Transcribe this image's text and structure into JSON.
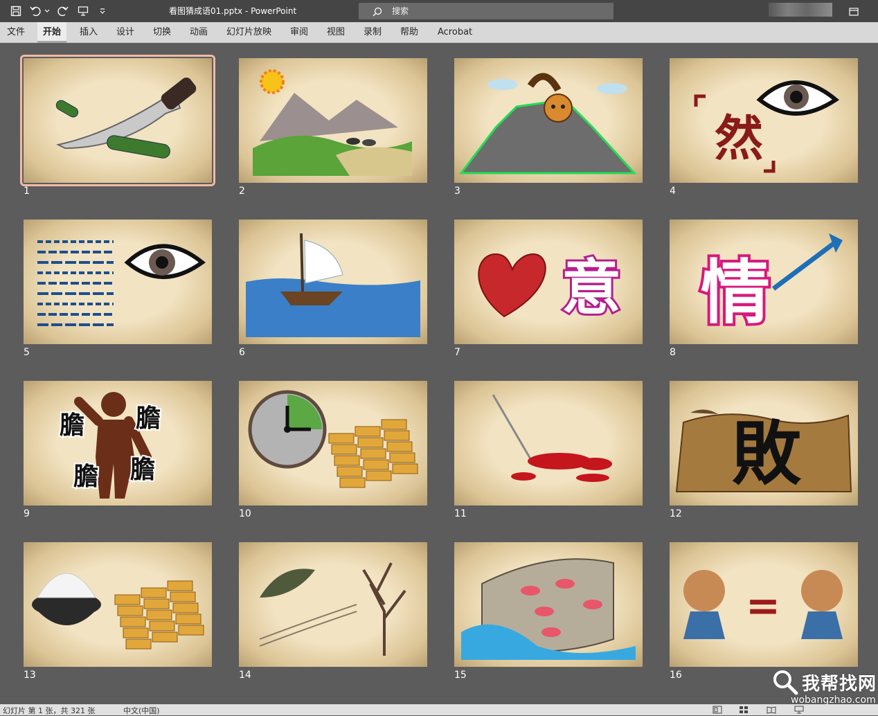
{
  "window": {
    "title": "看图猜成语01.pptx  -  PowerPoint"
  },
  "quick_access": [
    {
      "name": "save-icon"
    },
    {
      "name": "undo-icon"
    },
    {
      "name": "redo-icon"
    },
    {
      "name": "present-icon"
    },
    {
      "name": "customize-icon"
    }
  ],
  "search": {
    "placeholder": "搜索"
  },
  "ribbon": {
    "tabs": [
      "文件",
      "开始",
      "插入",
      "设计",
      "切换",
      "动画",
      "幻灯片放映",
      "审阅",
      "视图",
      "录制",
      "帮助",
      "Acrobat"
    ],
    "active_tab": "开始"
  },
  "slides": [
    {
      "number": "1",
      "selected": true,
      "art": "knife-cucumber"
    },
    {
      "number": "2",
      "art": "sun-mountains"
    },
    {
      "number": "3",
      "art": "raccoon-mountain"
    },
    {
      "number": "4",
      "art": "eye-ran"
    },
    {
      "number": "5",
      "art": "text-lines-eye"
    },
    {
      "number": "6",
      "art": "sailboat"
    },
    {
      "number": "7",
      "art": "heart-yi"
    },
    {
      "number": "8",
      "art": "qing-arrow"
    },
    {
      "number": "9",
      "art": "figure-dan"
    },
    {
      "number": "10",
      "art": "clock-gold"
    },
    {
      "number": "11",
      "art": "needle-blood"
    },
    {
      "number": "12",
      "art": "bai-cracked"
    },
    {
      "number": "13",
      "art": "rice-gold"
    },
    {
      "number": "14",
      "art": "leaf-tree"
    },
    {
      "number": "15",
      "art": "fish-net"
    },
    {
      "number": "16",
      "art": "twin-boys"
    }
  ],
  "glyphs": {
    "ran": "然",
    "yi": "意",
    "qing": "情",
    "dan": "膽",
    "bai": "敗",
    "equals": "="
  },
  "status": {
    "slide_info": "幻灯片 第 1 张，共 321 张",
    "language": "中文(中国)"
  },
  "watermark": {
    "text": "我帮找网",
    "url": "wobangzhao.com"
  },
  "colors": {
    "titlebar": "#454545",
    "ribbon": "#d8d8d8",
    "workspace": "#5c5c5c",
    "selection": "#f1b9a6"
  }
}
